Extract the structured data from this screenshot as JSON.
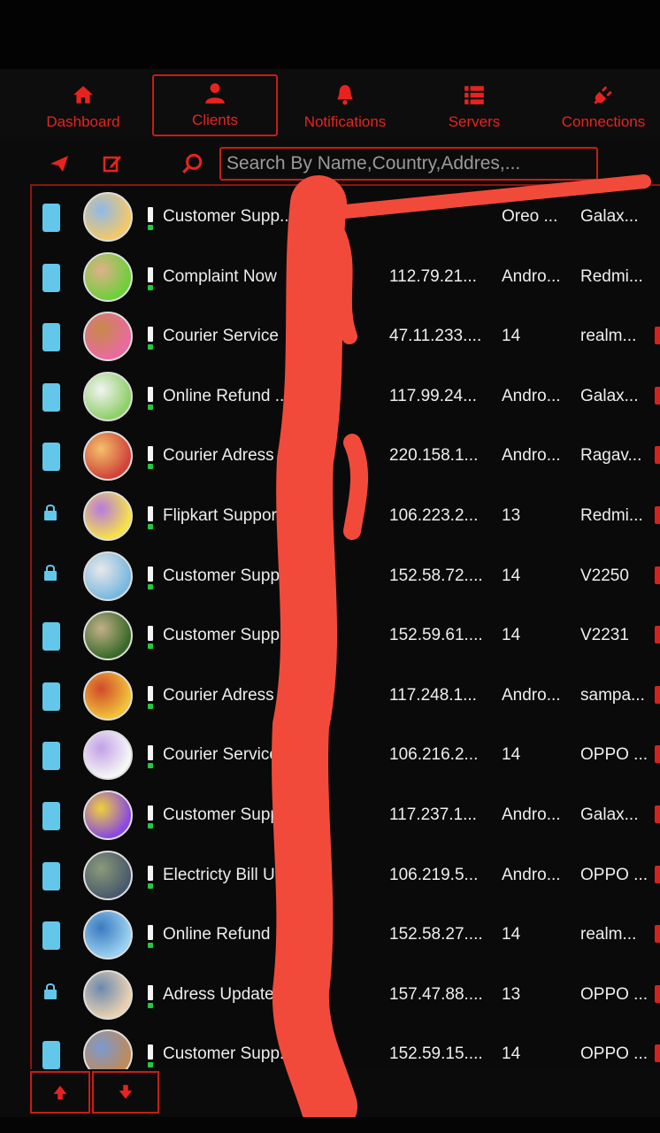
{
  "nav": {
    "items": [
      {
        "label": "Dashboard",
        "icon": "home-icon"
      },
      {
        "label": "Clients",
        "icon": "user-icon",
        "active": true
      },
      {
        "label": "Notifications",
        "icon": "bell-icon"
      },
      {
        "label": "Servers",
        "icon": "server-icon"
      },
      {
        "label": "Connections",
        "icon": "plug-icon"
      }
    ]
  },
  "toolbar": {
    "search_placeholder": "Search By Name,Country,Addres,..."
  },
  "colors": {
    "accent": "#e8231f",
    "online": "#23c93c",
    "device": "#63c7ea",
    "background": "#0b0b0b"
  },
  "rows": [
    {
      "name": "Customer Supp...",
      "ip": "",
      "os": "Oreo ...",
      "model": "Galax...",
      "device": "phone"
    },
    {
      "name": "Complaint Now",
      "ip": "112.79.21...",
      "os": "Andro...",
      "model": "Redmi...",
      "device": "phone"
    },
    {
      "name": "Courier Service",
      "ip": "47.11.233....",
      "os": "14",
      "model": "realm...",
      "device": "phone"
    },
    {
      "name": "Online Refund ...",
      "ip": "117.99.24...",
      "os": "Andro...",
      "model": "Galax...",
      "device": "phone"
    },
    {
      "name": "Courier Adress ...",
      "ip": "220.158.1...",
      "os": "Andro...",
      "model": "Ragav...",
      "device": "phone"
    },
    {
      "name": "Flipkart Support",
      "ip": "106.223.2...",
      "os": "13",
      "model": "Redmi...",
      "device": "locked"
    },
    {
      "name": "Customer Supp...",
      "ip": "152.58.72....",
      "os": "14",
      "model": "V2250",
      "device": "locked"
    },
    {
      "name": "Customer Supp...",
      "ip": "152.59.61....",
      "os": "14",
      "model": "V2231",
      "device": "phone"
    },
    {
      "name": "Courier Adress ...",
      "ip": "117.248.1...",
      "os": "Andro...",
      "model": "sampa...",
      "device": "phone"
    },
    {
      "name": "Courier Service",
      "ip": "106.216.2...",
      "os": "14",
      "model": "OPPO ...",
      "device": "phone"
    },
    {
      "name": "Customer Supp...",
      "ip": "117.237.1...",
      "os": "Andro...",
      "model": "Galax...",
      "device": "phone"
    },
    {
      "name": "Electricty Bill U...",
      "ip": "106.219.5...",
      "os": "Andro...",
      "model": "OPPO ...",
      "device": "phone"
    },
    {
      "name": "Online Refund ...",
      "ip": "152.58.27....",
      "os": "14",
      "model": "realm...",
      "device": "phone"
    },
    {
      "name": "Adress Update",
      "ip": "157.47.88....",
      "os": "13",
      "model": "OPPO ...",
      "device": "locked"
    },
    {
      "name": "Customer Supp...",
      "ip": "152.59.15....",
      "os": "14",
      "model": "OPPO ...",
      "device": "phone"
    }
  ],
  "pager": {
    "up_icon": "arrow-up-icon",
    "down_icon": "arrow-down-icon"
  }
}
